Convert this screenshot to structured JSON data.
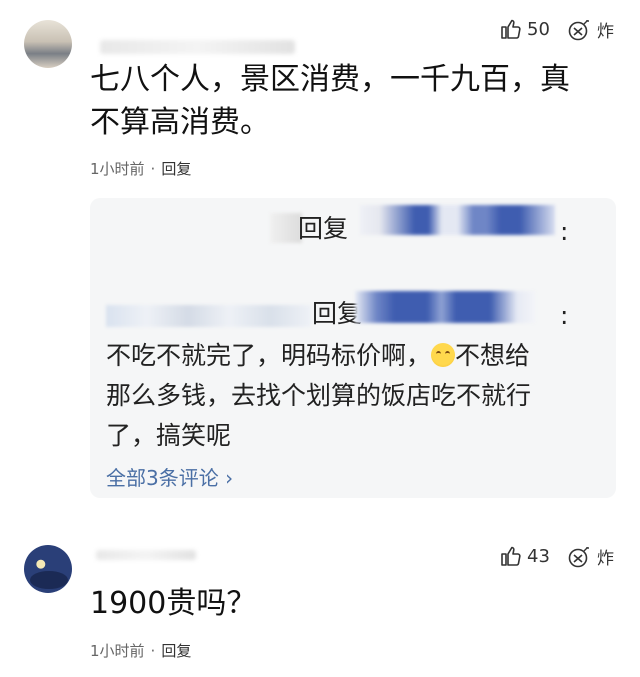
{
  "comments": [
    {
      "likes": "50",
      "bomb_label": "炸",
      "text_line1": "七八个人，景区消费，一千九百，真",
      "text_line2": "不算高消费。",
      "time": "1小时前",
      "dot": "·",
      "reply": "回复"
    },
    {
      "likes": "43",
      "bomb_label": "炸",
      "text": "1900贵吗？",
      "time": "1小时前",
      "dot": "·",
      "reply": "回复"
    }
  ],
  "replies": {
    "line1_reply": "回复",
    "line1_colon": ":",
    "line2_reply": "回复",
    "line2_colon": ":",
    "body_part1": "不吃不就完了，明码标价啊，",
    "body_part2": "不想给",
    "body_line2": "那么多钱，去找个划算的饭店吃不就行",
    "body_line3": "了，搞笑呢",
    "more_label": "全部3条评论 ›"
  },
  "icons": {
    "like": "thumbs-up-icon",
    "bomb": "bomb-icon",
    "emoji": "rolling-eyes-emoji-icon"
  },
  "colors": {
    "reply_bg": "#f5f6f7",
    "link": "#4a6fa5",
    "blur_blue": "#4f6fbf"
  }
}
